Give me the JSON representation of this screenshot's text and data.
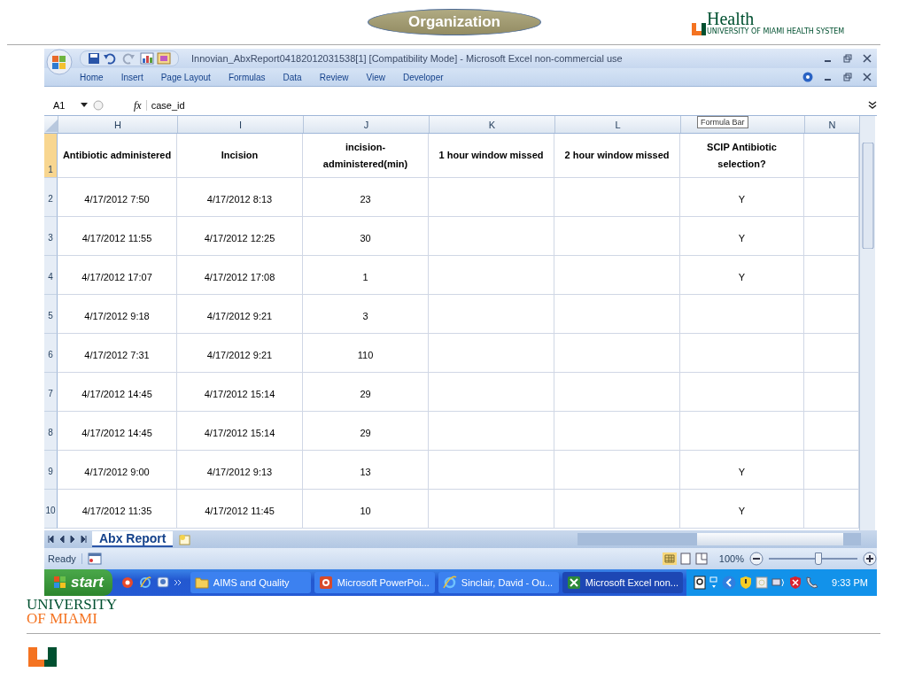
{
  "slide": {
    "title": "Organization",
    "logo_text": "Health",
    "logo_subtext": "UNIVERSITY OF MIAMI HEALTH SYSTEM",
    "footer_line1": "UNIVERSITY",
    "footer_line2": "OF MIAMI"
  },
  "window": {
    "title": "Innovian_AbxReport04182012031538[1]  [Compatibility Mode] - Microsoft Excel non-commercial use"
  },
  "ribbon_tabs": [
    {
      "label": "Home"
    },
    {
      "label": "Insert"
    },
    {
      "label": "Page Layout"
    },
    {
      "label": "Formulas"
    },
    {
      "label": "Data"
    },
    {
      "label": "Review"
    },
    {
      "label": "View"
    },
    {
      "label": "Developer"
    }
  ],
  "formula_bar": {
    "cell": "A1",
    "fx": "fx",
    "value": "case_id",
    "tooltip": "Formula Bar"
  },
  "columns": [
    {
      "letter": "H"
    },
    {
      "letter": "I"
    },
    {
      "letter": "J"
    },
    {
      "letter": "K"
    },
    {
      "letter": "L"
    },
    {
      "letter": "N"
    }
  ],
  "header_row": {
    "number": "1",
    "h": "Antibiotic administered",
    "i": "Incision",
    "j": "incision-administered(min)",
    "k": "1 hour window missed",
    "l": "2 hour window missed",
    "m": "SCIP Antibiotic selection?"
  },
  "rows": [
    {
      "number": "2",
      "h": "4/17/2012 7:50",
      "i": "4/17/2012 8:13",
      "j": "23",
      "m": "Y"
    },
    {
      "number": "3",
      "h": "4/17/2012 11:55",
      "i": "4/17/2012 12:25",
      "j": "30",
      "m": "Y"
    },
    {
      "number": "4",
      "h": "4/17/2012 17:07",
      "i": "4/17/2012 17:08",
      "j": "1",
      "m": "Y"
    },
    {
      "number": "5",
      "h": "4/17/2012 9:18",
      "i": "4/17/2012 9:21",
      "j": "3"
    },
    {
      "number": "6",
      "h": "4/17/2012 7:31",
      "i": "4/17/2012 9:21",
      "j": "110"
    },
    {
      "number": "7",
      "h": "4/17/2012 14:45",
      "i": "4/17/2012 15:14",
      "j": "29"
    },
    {
      "number": "8",
      "h": "4/17/2012 14:45",
      "i": "4/17/2012 15:14",
      "j": "29"
    },
    {
      "number": "9",
      "h": "4/17/2012 9:00",
      "i": "4/17/2012 9:13",
      "j": "13",
      "m": "Y"
    },
    {
      "number": "10",
      "h": "4/17/2012 11:35",
      "i": "4/17/2012 11:45",
      "j": "10",
      "m": "Y"
    }
  ],
  "sheet_tabs": [
    {
      "label": "Abx Report",
      "selected": true
    }
  ],
  "status_bar": {
    "text": "Ready",
    "zoom": "100%",
    "zoom_level": {
      "level": 0.55
    }
  },
  "taskbar": {
    "start": "start",
    "buttons": [
      {
        "label": "AIMS and Quality",
        "selected": false,
        "kind": "folder"
      },
      {
        "label": "Microsoft PowerPoi...",
        "selected": false,
        "kind": "presentation"
      },
      {
        "label": "Sinclair, David - Ou...",
        "selected": false,
        "kind": "browser"
      },
      {
        "label": "Microsoft Excel non...",
        "selected": true,
        "kind": "spreadsheet"
      }
    ],
    "clock": "9:33 PM"
  }
}
